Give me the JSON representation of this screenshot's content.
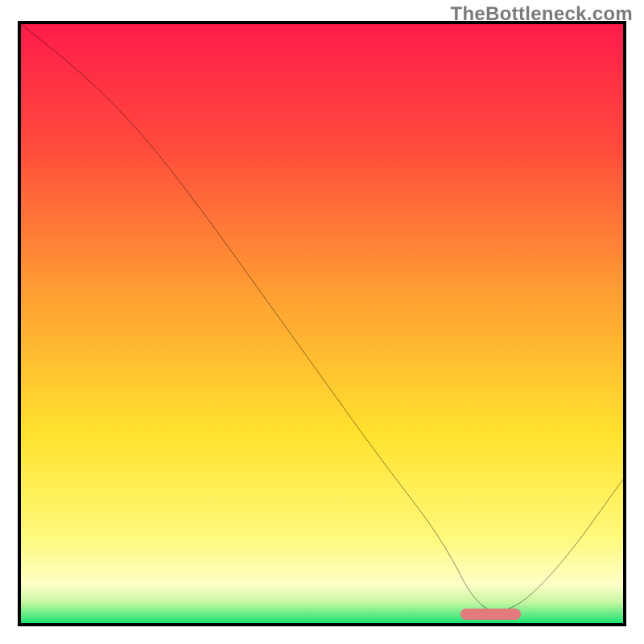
{
  "watermark": "TheBottleneck.com",
  "chart_data": {
    "type": "line",
    "title": "",
    "xlabel": "",
    "ylabel": "",
    "x_range": [
      0,
      100
    ],
    "y_range": [
      0,
      100
    ],
    "series": [
      {
        "name": "bottleneck-curve",
        "x": [
          0,
          10,
          20,
          30,
          40,
          50,
          60,
          70,
          76,
          82,
          90,
          100
        ],
        "y": [
          100,
          92,
          82,
          69,
          55,
          41,
          27,
          14,
          2,
          2,
          10,
          24
        ]
      }
    ],
    "optimum_band": {
      "x_start": 73,
      "x_end": 83,
      "y": 1.5
    },
    "gradient_stops": [
      {
        "pct": 0,
        "color": "#ff1c4b"
      },
      {
        "pct": 20,
        "color": "#ff4a3c"
      },
      {
        "pct": 45,
        "color": "#ffa033"
      },
      {
        "pct": 68,
        "color": "#ffe22e"
      },
      {
        "pct": 85,
        "color": "#fff97a"
      },
      {
        "pct": 93,
        "color": "#fdffc7"
      },
      {
        "pct": 96,
        "color": "#c8f7a2"
      },
      {
        "pct": 100,
        "color": "#00e06a"
      }
    ]
  }
}
